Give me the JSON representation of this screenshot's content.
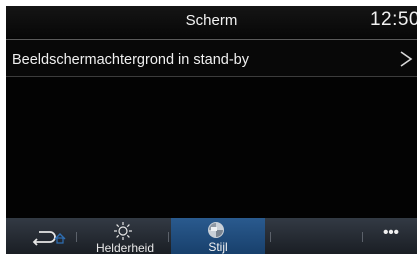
{
  "header": {
    "title": "Scherm",
    "clock": "12:50"
  },
  "settings_row": {
    "label": "Beeldschermachtergrond in stand-by"
  },
  "bottom_bar": {
    "brightness_label": "Helderheid",
    "style_label": "Stijl",
    "more_label": "•••",
    "active_tab": "Stijl"
  },
  "colors": {
    "panel_background": "#050505",
    "active_tab": "#1f4f82",
    "back_arrow_accent": "#2e6fb5"
  }
}
